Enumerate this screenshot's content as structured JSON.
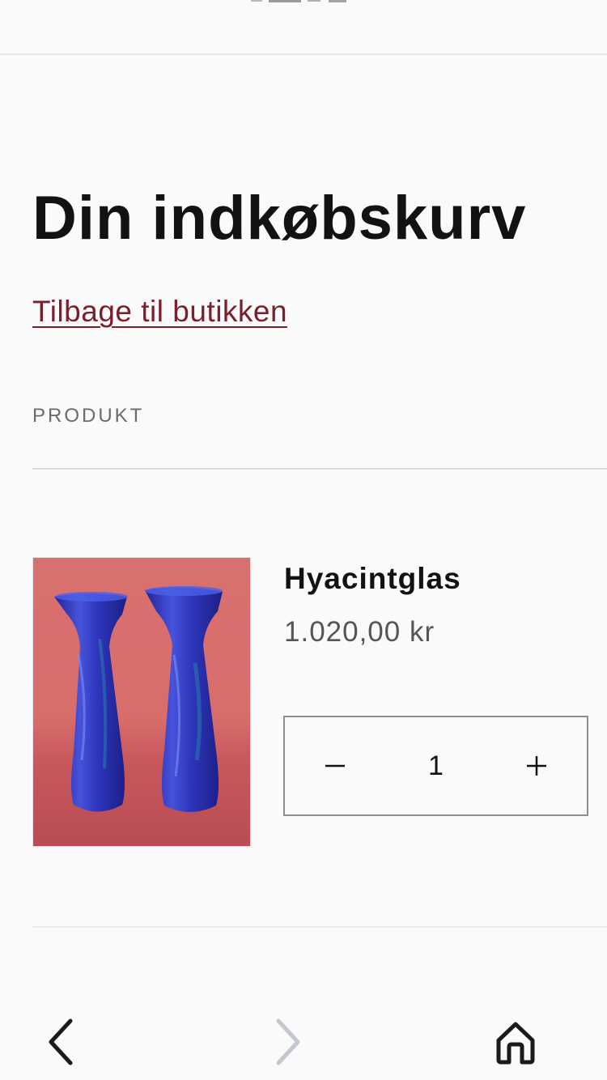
{
  "cart": {
    "title": "Din indkøbskurv",
    "back_link": "Tilbage til butikken",
    "column_header": "PRODUKT"
  },
  "items": [
    {
      "name": "Hyacintglas",
      "price": "1.020,00 kr",
      "quantity": "1"
    }
  ],
  "quantity_controls": {
    "decrease_icon": "minus-icon",
    "increase_icon": "plus-icon"
  },
  "browser_nav": {
    "back_icon": "chevron-left-icon",
    "forward_icon": "chevron-right-icon",
    "home_icon": "home-icon"
  },
  "colors": {
    "link": "#7a1f2b",
    "text": "#121212",
    "muted": "#555555",
    "background": "#fafafa"
  }
}
